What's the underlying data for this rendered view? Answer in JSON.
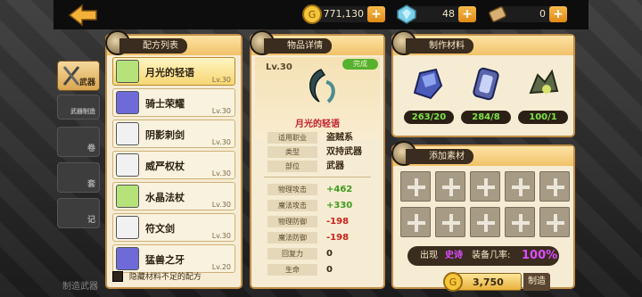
{
  "topbar": {
    "gold": "771,130",
    "gems": "48",
    "tickets": "0",
    "plus": "+"
  },
  "side_tabs": [
    {
      "label": "武器",
      "active": true
    },
    {
      "label": "武器制造",
      "active": false
    },
    {
      "label": "卷",
      "active": false
    },
    {
      "label": "套",
      "active": false
    },
    {
      "label": "记",
      "active": false
    }
  ],
  "bottom_caption": "制造武器",
  "recipe_panel": {
    "title": "配方列表",
    "items": [
      {
        "name": "月光的轻语",
        "level": "Lv.30",
        "icon_color": "#b6e27a",
        "selected": true
      },
      {
        "name": "骑士荣耀",
        "level": "Lv.30",
        "icon_color": "#6e6ad8",
        "selected": false
      },
      {
        "name": "阴影刺剑",
        "level": "Lv.30",
        "icon_color": "#f1f1f1",
        "selected": false
      },
      {
        "name": "威严权杖",
        "level": "Lv.30",
        "icon_color": "#f1f1f1",
        "selected": false
      },
      {
        "name": "水晶法杖",
        "level": "Lv.30",
        "icon_color": "#b6e27a",
        "selected": false
      },
      {
        "name": "符文剑",
        "level": "Lv.30",
        "icon_color": "#f1f1f1",
        "selected": false
      },
      {
        "name": "猛兽之牙",
        "level": "Lv.20",
        "icon_color": "#6e6ad8",
        "selected": false
      }
    ],
    "filter_label": "隐藏材料不足的配方"
  },
  "detail_panel": {
    "title": "物品详情",
    "level": "Lv.30",
    "badge": "完成",
    "item_name": "月光的轻语",
    "info": [
      {
        "key": "适用职业",
        "value": "盗贼系"
      },
      {
        "key": "类型",
        "value": "双持武器"
      },
      {
        "key": "部位",
        "value": "武器"
      }
    ],
    "stats": [
      {
        "key": "物理攻击",
        "value": "+462",
        "color": "#3f9b1e"
      },
      {
        "key": "魔法攻击",
        "value": "+330",
        "color": "#3f9b1e"
      },
      {
        "key": "物理防御",
        "value": "-198",
        "color": "#c8221c"
      },
      {
        "key": "魔法防御",
        "value": "-198",
        "color": "#c8221c"
      },
      {
        "key": "回复力",
        "value": "0",
        "color": "#3a2a14"
      },
      {
        "key": "生命",
        "value": "0",
        "color": "#3a2a14"
      }
    ]
  },
  "materials_panel": {
    "title": "制作材料",
    "items": [
      {
        "count": "263/20",
        "icon": "gem-ore-icon"
      },
      {
        "count": "284/8",
        "icon": "rune-stone-icon"
      },
      {
        "count": "100/1",
        "icon": "claw-relic-icon"
      }
    ]
  },
  "add_panel": {
    "title": "添加素材",
    "odds_prefix": "出现",
    "odds_tier": "史诗",
    "odds_middle": "装备几率:",
    "odds_value": "100%",
    "cost": "3,750",
    "craft_label": "制造"
  }
}
